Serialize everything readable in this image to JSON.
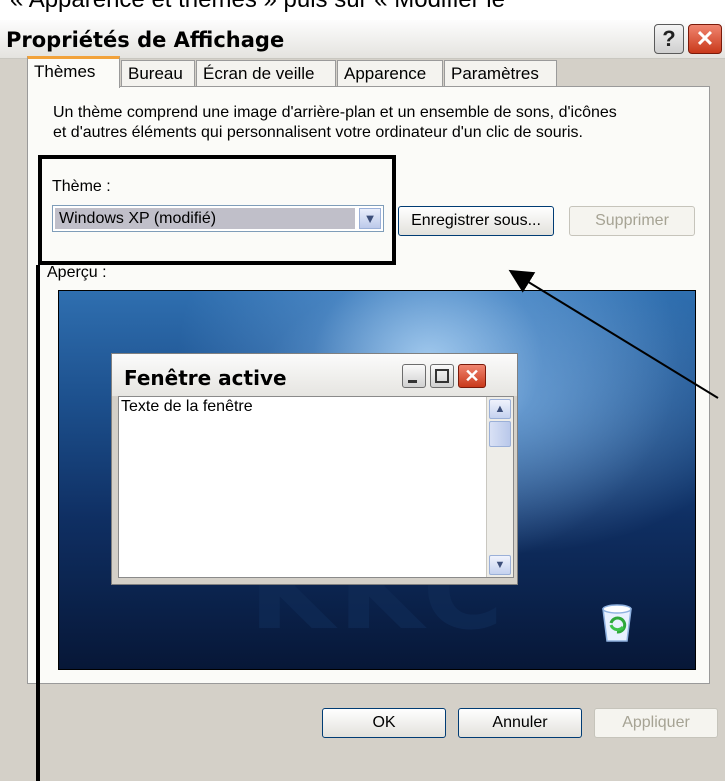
{
  "caption": "« Apparence et thèmes » puis sur « Modifier le",
  "dialog": {
    "title": "Propriétés de Affichage",
    "help_glyph": "?",
    "close_glyph": "✕"
  },
  "tabs": [
    "Thèmes",
    "Bureau",
    "Écran de veille",
    "Apparence",
    "Paramètres"
  ],
  "themes": {
    "description_line1": "Un thème comprend une image d'arrière-plan et un ensemble de sons, d'icônes",
    "description_line2": "et d'autres éléments qui personnalisent votre ordinateur d'un clic de souris.",
    "theme_label": "Thème :",
    "theme_value": "Windows XP (modifié)",
    "save_as_label": "Enregistrer sous...",
    "delete_label": "Supprimer",
    "preview_label": "Aperçu :"
  },
  "preview": {
    "brand_text": "KKC",
    "window_title": "Fenêtre active",
    "window_text": "Texte de la fenêtre",
    "recycle_icon": "recycle-bin-icon"
  },
  "footer": {
    "ok_label": "OK",
    "cancel_label": "Annuler",
    "apply_label": "Appliquer"
  },
  "colors": {
    "tab_accent": "#f2a23a",
    "close_red": "#c9391b",
    "dialog_bg": "#d4d0c8"
  }
}
